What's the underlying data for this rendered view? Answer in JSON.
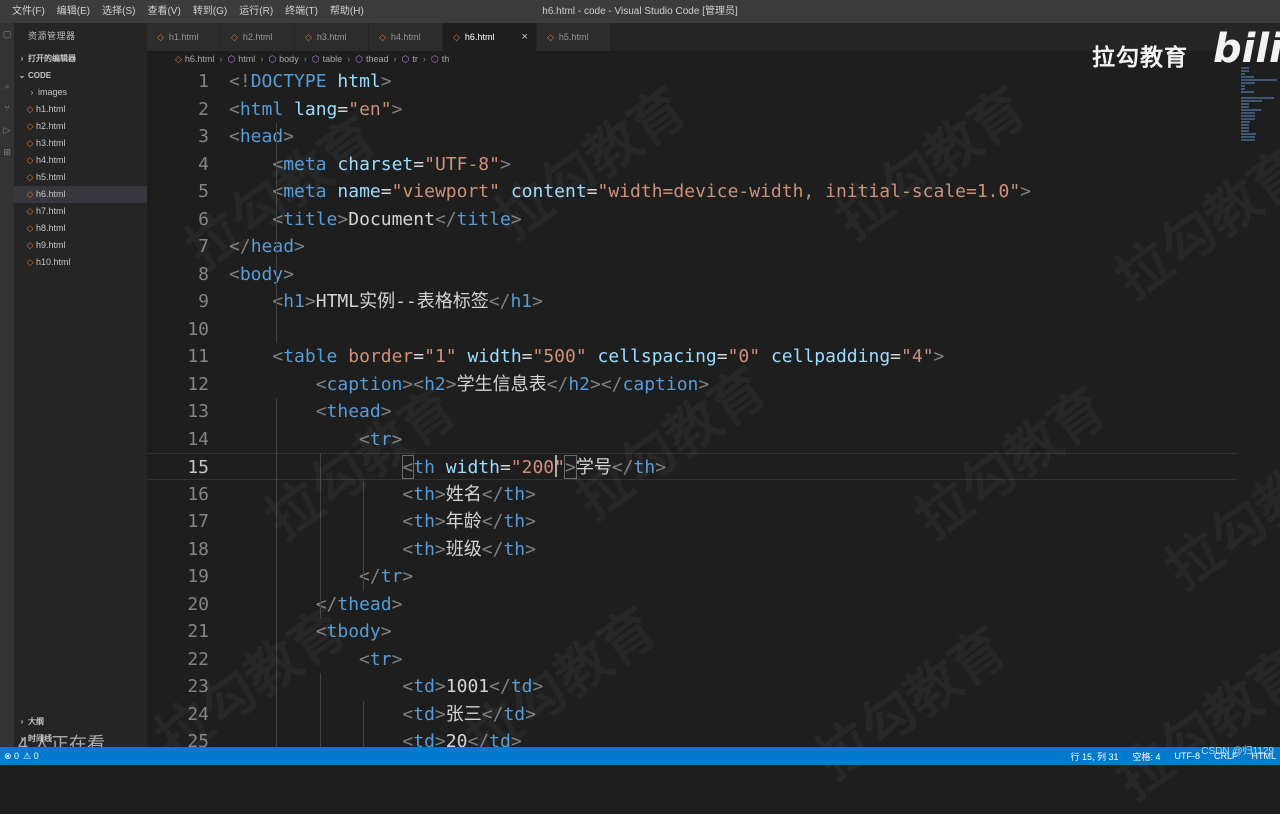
{
  "window": {
    "title": "h6.html - code - Visual Studio Code [管理员]",
    "menu": [
      "文件(F)",
      "编辑(E)",
      "选择(S)",
      "查看(V)",
      "转到(G)",
      "运行(R)",
      "终端(T)",
      "帮助(H)"
    ]
  },
  "sidebar": {
    "header": "资源管理器",
    "open_editors": "打开的编辑器",
    "root": "CODE",
    "folder": "images",
    "files": [
      "h1.html",
      "h2.html",
      "h3.html",
      "h4.html",
      "h5.html",
      "h6.html",
      "h7.html",
      "h8.html",
      "h9.html",
      "h10.html"
    ],
    "active_file": "h6.html",
    "outline": "大纲",
    "timeline": "时间线"
  },
  "viewer_overlay": "4 人正在看",
  "tabs": [
    {
      "label": "h1.html",
      "active": false
    },
    {
      "label": "h2.html",
      "active": false
    },
    {
      "label": "h3.html",
      "active": false
    },
    {
      "label": "h4.html",
      "active": false
    },
    {
      "label": "h6.html",
      "active": true
    },
    {
      "label": "h5.html",
      "active": false
    }
  ],
  "breadcrumb": [
    "h6.html",
    "html",
    "body",
    "table",
    "thead",
    "tr",
    "th"
  ],
  "editor": {
    "current_line": 15,
    "lines": [
      {
        "n": "1",
        "t": [
          [
            "br",
            "<!"
          ],
          [
            "tag",
            "DOCTYPE"
          ],
          [
            "txt",
            " "
          ],
          [
            "attr",
            "html"
          ],
          [
            "br",
            ">"
          ]
        ]
      },
      {
        "n": "2",
        "t": [
          [
            "br",
            "<"
          ],
          [
            "tag",
            "html"
          ],
          [
            "txt",
            " "
          ],
          [
            "attr",
            "lang"
          ],
          [
            "txt",
            "="
          ],
          [
            "str",
            "\"en\""
          ],
          [
            "br",
            ">"
          ]
        ]
      },
      {
        "n": "3",
        "t": [
          [
            "br",
            "<"
          ],
          [
            "tag",
            "head"
          ],
          [
            "br",
            ">"
          ]
        ]
      },
      {
        "n": "4",
        "t": [
          [
            "txt",
            "    "
          ],
          [
            "br",
            "<"
          ],
          [
            "tag",
            "meta"
          ],
          [
            "txt",
            " "
          ],
          [
            "attr",
            "charset"
          ],
          [
            "txt",
            "="
          ],
          [
            "str",
            "\"UTF-8\""
          ],
          [
            "br",
            ">"
          ]
        ]
      },
      {
        "n": "5",
        "t": [
          [
            "txt",
            "    "
          ],
          [
            "br",
            "<"
          ],
          [
            "tag",
            "meta"
          ],
          [
            "txt",
            " "
          ],
          [
            "attr",
            "name"
          ],
          [
            "txt",
            "="
          ],
          [
            "str",
            "\"viewport\""
          ],
          [
            "txt",
            " "
          ],
          [
            "attr",
            "content"
          ],
          [
            "txt",
            "="
          ],
          [
            "str",
            "\"width=device-width, initial-scale=1.0\""
          ],
          [
            "br",
            ">"
          ]
        ]
      },
      {
        "n": "6",
        "t": [
          [
            "txt",
            "    "
          ],
          [
            "br",
            "<"
          ],
          [
            "tag",
            "title"
          ],
          [
            "br",
            ">"
          ],
          [
            "txt",
            "Document"
          ],
          [
            "br",
            "</"
          ],
          [
            "tag",
            "title"
          ],
          [
            "br",
            ">"
          ]
        ]
      },
      {
        "n": "7",
        "t": [
          [
            "br",
            "</"
          ],
          [
            "tag",
            "head"
          ],
          [
            "br",
            ">"
          ]
        ]
      },
      {
        "n": "8",
        "t": [
          [
            "br",
            "<"
          ],
          [
            "tag",
            "body"
          ],
          [
            "br",
            ">"
          ]
        ]
      },
      {
        "n": "9",
        "t": [
          [
            "txt",
            "    "
          ],
          [
            "br",
            "<"
          ],
          [
            "tag",
            "h1"
          ],
          [
            "br",
            ">"
          ],
          [
            "txt",
            "HTML实例--表格标签"
          ],
          [
            "br",
            "</"
          ],
          [
            "tag",
            "h1"
          ],
          [
            "br",
            ">"
          ]
        ]
      },
      {
        "n": "10",
        "t": []
      },
      {
        "n": "11",
        "t": [
          [
            "txt",
            "    "
          ],
          [
            "br",
            "<"
          ],
          [
            "tag",
            "table"
          ],
          [
            "txt",
            " "
          ],
          [
            "str",
            "border"
          ],
          [
            "txt",
            "="
          ],
          [
            "str",
            "\"1\""
          ],
          [
            "txt",
            " "
          ],
          [
            "attr",
            "width"
          ],
          [
            "txt",
            "="
          ],
          [
            "str",
            "\"500\""
          ],
          [
            "txt",
            " "
          ],
          [
            "attr",
            "cellspacing"
          ],
          [
            "txt",
            "="
          ],
          [
            "str",
            "\"0\""
          ],
          [
            "txt",
            " "
          ],
          [
            "attr",
            "cellpadding"
          ],
          [
            "txt",
            "="
          ],
          [
            "str",
            "\"4\""
          ],
          [
            "br",
            ">"
          ]
        ]
      },
      {
        "n": "12",
        "t": [
          [
            "txt",
            "        "
          ],
          [
            "br",
            "<"
          ],
          [
            "tag",
            "caption"
          ],
          [
            "br",
            "><"
          ],
          [
            "tag",
            "h2"
          ],
          [
            "br",
            ">"
          ],
          [
            "txt",
            "学生信息表"
          ],
          [
            "br",
            "</"
          ],
          [
            "tag",
            "h2"
          ],
          [
            "br",
            "></"
          ],
          [
            "tag",
            "caption"
          ],
          [
            "br",
            ">"
          ]
        ]
      },
      {
        "n": "13",
        "t": [
          [
            "txt",
            "        "
          ],
          [
            "br",
            "<"
          ],
          [
            "tag",
            "thead"
          ],
          [
            "br",
            ">"
          ]
        ]
      },
      {
        "n": "14",
        "t": [
          [
            "txt",
            "            "
          ],
          [
            "br",
            "<"
          ],
          [
            "tag",
            "tr"
          ],
          [
            "br",
            ">"
          ]
        ]
      },
      {
        "n": "15",
        "t": [
          [
            "txt",
            "                "
          ],
          [
            "br",
            "<"
          ],
          [
            "tag",
            "th"
          ],
          [
            "txt",
            " "
          ],
          [
            "attr",
            "width"
          ],
          [
            "txt",
            "="
          ],
          [
            "str",
            "\"200\""
          ],
          [
            "br",
            ">"
          ],
          [
            "txt",
            "学号"
          ],
          [
            "br",
            "</"
          ],
          [
            "tag",
            "th"
          ],
          [
            "br",
            ">"
          ]
        ]
      },
      {
        "n": "16",
        "t": [
          [
            "txt",
            "                "
          ],
          [
            "br",
            "<"
          ],
          [
            "tag",
            "th"
          ],
          [
            "br",
            ">"
          ],
          [
            "txt",
            "姓名"
          ],
          [
            "br",
            "</"
          ],
          [
            "tag",
            "th"
          ],
          [
            "br",
            ">"
          ]
        ]
      },
      {
        "n": "17",
        "t": [
          [
            "txt",
            "                "
          ],
          [
            "br",
            "<"
          ],
          [
            "tag",
            "th"
          ],
          [
            "br",
            ">"
          ],
          [
            "txt",
            "年龄"
          ],
          [
            "br",
            "</"
          ],
          [
            "tag",
            "th"
          ],
          [
            "br",
            ">"
          ]
        ]
      },
      {
        "n": "18",
        "t": [
          [
            "txt",
            "                "
          ],
          [
            "br",
            "<"
          ],
          [
            "tag",
            "th"
          ],
          [
            "br",
            ">"
          ],
          [
            "txt",
            "班级"
          ],
          [
            "br",
            "</"
          ],
          [
            "tag",
            "th"
          ],
          [
            "br",
            ">"
          ]
        ]
      },
      {
        "n": "19",
        "t": [
          [
            "txt",
            "            "
          ],
          [
            "br",
            "</"
          ],
          [
            "tag",
            "tr"
          ],
          [
            "br",
            ">"
          ]
        ]
      },
      {
        "n": "20",
        "t": [
          [
            "txt",
            "        "
          ],
          [
            "br",
            "</"
          ],
          [
            "tag",
            "thead"
          ],
          [
            "br",
            ">"
          ]
        ]
      },
      {
        "n": "21",
        "t": [
          [
            "txt",
            "        "
          ],
          [
            "br",
            "<"
          ],
          [
            "tag",
            "tbody"
          ],
          [
            "br",
            ">"
          ]
        ]
      },
      {
        "n": "22",
        "t": [
          [
            "txt",
            "            "
          ],
          [
            "br",
            "<"
          ],
          [
            "tag",
            "tr"
          ],
          [
            "br",
            ">"
          ]
        ]
      },
      {
        "n": "23",
        "t": [
          [
            "txt",
            "                "
          ],
          [
            "br",
            "<"
          ],
          [
            "tag",
            "td"
          ],
          [
            "br",
            ">"
          ],
          [
            "txt",
            "1001"
          ],
          [
            "br",
            "</"
          ],
          [
            "tag",
            "td"
          ],
          [
            "br",
            ">"
          ]
        ]
      },
      {
        "n": "24",
        "t": [
          [
            "txt",
            "                "
          ],
          [
            "br",
            "<"
          ],
          [
            "tag",
            "td"
          ],
          [
            "br",
            ">"
          ],
          [
            "txt",
            "张三"
          ],
          [
            "br",
            "</"
          ],
          [
            "tag",
            "td"
          ],
          [
            "br",
            ">"
          ]
        ]
      },
      {
        "n": "25",
        "t": [
          [
            "txt",
            "                "
          ],
          [
            "br",
            "<"
          ],
          [
            "tag",
            "td"
          ],
          [
            "br",
            ">"
          ],
          [
            "txt",
            "20"
          ],
          [
            "br",
            "</"
          ],
          [
            "tag",
            "td"
          ],
          [
            "br",
            ">"
          ]
        ]
      }
    ]
  },
  "watermark": {
    "brand": "拉勾教育",
    "bilibili": "bilib",
    "repeat_text": "拉勾教育"
  },
  "statusbar": {
    "left": [
      "⊗ 0",
      "⚠ 0"
    ],
    "position": "行 15, 列 31",
    "spaces": "空格: 4",
    "encoding": "UTF-8",
    "eol": "CRLF",
    "language": "HTML"
  },
  "credit": "CSDN @归1129"
}
